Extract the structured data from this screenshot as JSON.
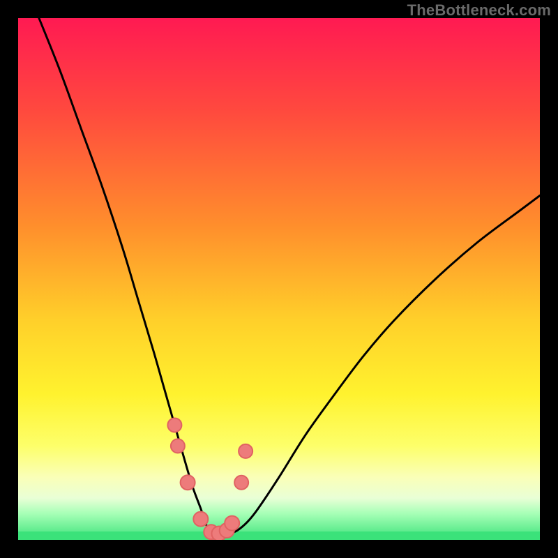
{
  "watermark": "TheBottleneck.com",
  "colors": {
    "frame": "#000000",
    "curve": "#000000",
    "marker_fill": "#ed7b7b",
    "marker_stroke": "#e06262",
    "green_band": "#3be27a",
    "gradient_stops": [
      {
        "offset": 0,
        "color": "#ff1a52"
      },
      {
        "offset": 18,
        "color": "#ff4a3e"
      },
      {
        "offset": 40,
        "color": "#ff8f2c"
      },
      {
        "offset": 58,
        "color": "#ffd02a"
      },
      {
        "offset": 72,
        "color": "#fff22e"
      },
      {
        "offset": 82,
        "color": "#fdff6a"
      },
      {
        "offset": 88,
        "color": "#faffb8"
      },
      {
        "offset": 92,
        "color": "#e9ffd6"
      },
      {
        "offset": 95,
        "color": "#a6ffb6"
      },
      {
        "offset": 100,
        "color": "#3be27a"
      }
    ]
  },
  "chart_data": {
    "type": "line",
    "title": "",
    "xlabel": "",
    "ylabel": "",
    "xlim": [
      0,
      100
    ],
    "ylim": [
      0,
      100
    ],
    "series": [
      {
        "name": "bottleneck-curve",
        "x": [
          4,
          8,
          12,
          16,
          20,
          23,
          26,
          28,
          30,
          32,
          33.5,
          35,
          36,
          37,
          38,
          39,
          40.5,
          42,
          44,
          46,
          50,
          55,
          60,
          66,
          72,
          80,
          88,
          96,
          100
        ],
        "y": [
          100,
          90,
          79,
          68,
          56,
          46,
          36,
          29,
          22,
          15,
          10,
          6,
          3,
          1.5,
          1,
          1,
          1.2,
          1.8,
          3.5,
          6,
          12,
          20,
          27,
          35,
          42,
          50,
          57,
          63,
          66
        ]
      }
    ],
    "markers": {
      "name": "highlight-points",
      "x": [
        30,
        30.6,
        32.5,
        35,
        37,
        38.5,
        40,
        41,
        42.8,
        43.6
      ],
      "y": [
        22,
        18,
        11,
        4,
        1.5,
        1.2,
        1.8,
        3.2,
        11,
        17
      ],
      "r": [
        10,
        10,
        10.5,
        10.5,
        10.5,
        10.5,
        10.5,
        10.5,
        10,
        10
      ]
    }
  }
}
